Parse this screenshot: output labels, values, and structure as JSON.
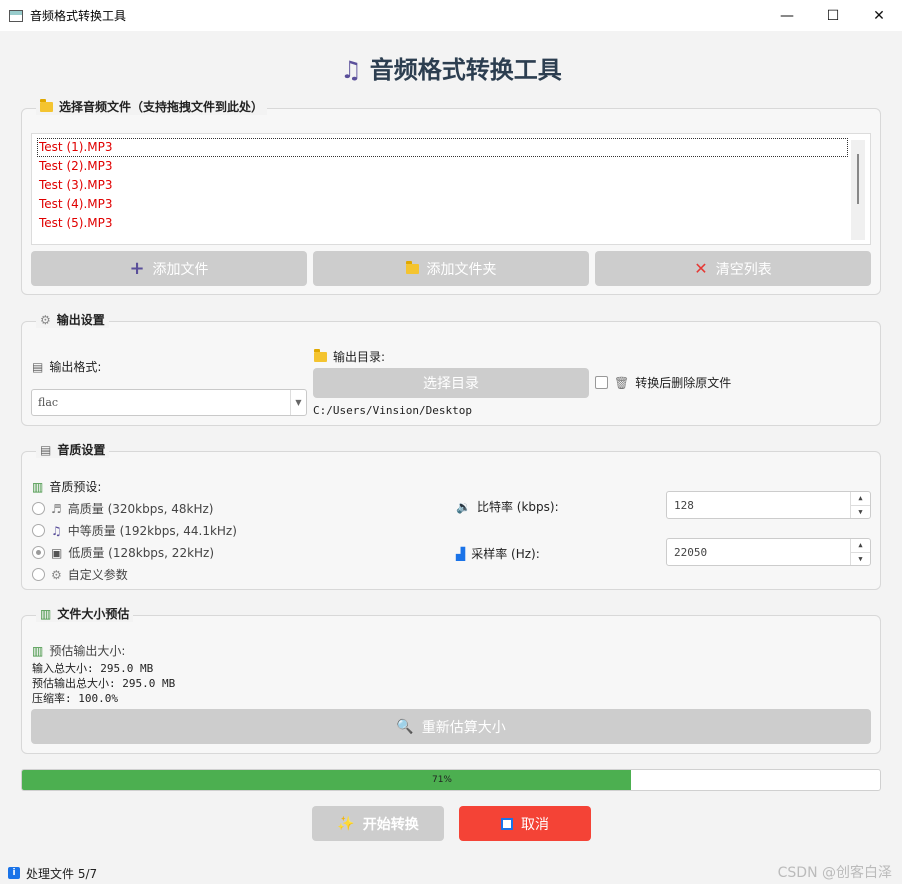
{
  "window": {
    "title": "音频格式转换工具",
    "min": "—",
    "max": "☐",
    "close": "✕"
  },
  "header": {
    "icon": "music-note-icon",
    "title": "音频格式转换工具"
  },
  "file_group": {
    "title": "选择音频文件（支持拖拽文件到此处）",
    "files": [
      "Test (1).MP3",
      "Test (2).MP3",
      "Test (3).MP3",
      "Test (4).MP3",
      "Test (5).MP3"
    ],
    "add_files": "添加文件",
    "add_folder": "添加文件夹",
    "clear_list": "清空列表"
  },
  "output_group": {
    "title": "输出设置",
    "format_label": "输出格式:",
    "format_value": "flac",
    "dir_label": "输出目录:",
    "choose_dir": "选择目录",
    "dir_path": "C:/Users/Vinsion/Desktop",
    "delete_label": "转换后删除原文件"
  },
  "quality_group": {
    "title": "音质设置",
    "preset_label": "音质预设:",
    "presets": [
      {
        "label": "高质量 (320kbps, 48kHz)",
        "checked": false
      },
      {
        "label": "中等质量 (192kbps, 44.1kHz)",
        "checked": false
      },
      {
        "label": "低质量 (128kbps, 22kHz)",
        "checked": true
      },
      {
        "label": "自定义参数",
        "checked": false
      }
    ],
    "bitrate_label": "比特率 (kbps):",
    "bitrate_value": "128",
    "samplerate_label": "采样率 (Hz):",
    "samplerate_value": "22050"
  },
  "size_group": {
    "title": "文件大小预估",
    "estimate_title": "预估输出大小:",
    "input_total": "输入总大小: 295.0 MB",
    "output_total": "预估输出总大小: 295.0 MB",
    "ratio": "压缩率: 100.0%",
    "recalc": "重新估算大小"
  },
  "progress": {
    "value": 0.71,
    "label": "71%"
  },
  "actions": {
    "start": "开始转换",
    "cancel": "取消"
  },
  "status": {
    "text": "处理文件 5/7"
  },
  "watermark": "CSDN @创客白泽",
  "colors": {
    "progress": "#4caf50",
    "cancel": "#f44336",
    "file_text": "#e00000",
    "title": "#2c3e50"
  }
}
